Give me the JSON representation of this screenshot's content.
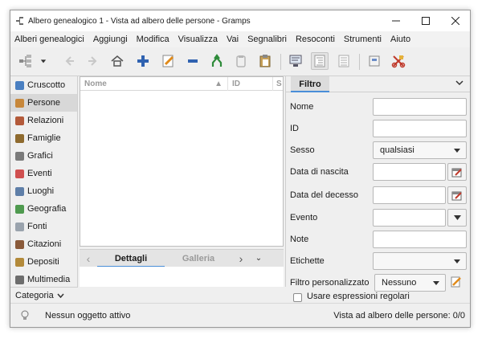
{
  "window": {
    "title": "Albero genealogico 1 - Vista ad albero delle persone - Gramps"
  },
  "menubar": [
    "Alberi genealogici",
    "Aggiungi",
    "Modifica",
    "Visualizza",
    "Vai",
    "Segnalibri",
    "Resoconti",
    "Strumenti",
    "Aiuto"
  ],
  "toolbar": {
    "icons": [
      "family-trees-icon",
      "dropdown-arrow-icon",
      "back-icon",
      "forward-icon",
      "home-icon",
      "add-icon",
      "edit-icon",
      "remove-icon",
      "merge-icon",
      "clipboard-icon",
      "paste-icon",
      "config-view-icon",
      "tree-view-icon",
      "flat-view-icon",
      "report-icon",
      "tools-icon"
    ]
  },
  "sidebar": {
    "items": [
      {
        "label": "Cruscotto",
        "icon": "dashboard-icon",
        "color": "#4a7fc1"
      },
      {
        "label": "Persone",
        "icon": "people-icon",
        "color": "#c7873a"
      },
      {
        "label": "Relazioni",
        "icon": "relationships-icon",
        "color": "#b35a3a"
      },
      {
        "label": "Famiglie",
        "icon": "families-icon",
        "color": "#8e6a2e"
      },
      {
        "label": "Grafici",
        "icon": "charts-icon",
        "color": "#7a7a7a"
      },
      {
        "label": "Eventi",
        "icon": "events-icon",
        "color": "#d05050"
      },
      {
        "label": "Luoghi",
        "icon": "places-icon",
        "color": "#5f7fa8"
      },
      {
        "label": "Geografia",
        "icon": "geography-icon",
        "color": "#4f9a4f"
      },
      {
        "label": "Fonti",
        "icon": "sources-icon",
        "color": "#9aa3ad"
      },
      {
        "label": "Citazioni",
        "icon": "citations-icon",
        "color": "#8a5a3a"
      },
      {
        "label": "Depositi",
        "icon": "repositories-icon",
        "color": "#b38a3a"
      },
      {
        "label": "Multimedia",
        "icon": "media-icon",
        "color": "#6d6d6d"
      }
    ],
    "active_index": 1,
    "category_label": "Categoria"
  },
  "list": {
    "columns": [
      "Nome",
      "ID",
      "S"
    ]
  },
  "bottombar": {
    "tabs": [
      "Dettagli",
      "Galleria"
    ],
    "active": "Dettagli"
  },
  "filter": {
    "tab_label": "Filtro",
    "fields": [
      {
        "label": "Nome",
        "type": "text",
        "value": ""
      },
      {
        "label": "ID",
        "type": "text",
        "value": ""
      },
      {
        "label": "Sesso",
        "type": "combo",
        "value": "qualsiasi"
      },
      {
        "label": "Data di nascita",
        "type": "date",
        "value": ""
      },
      {
        "label": "Data del decesso",
        "type": "date",
        "value": ""
      },
      {
        "label": "Evento",
        "type": "combo-entry",
        "value": ""
      },
      {
        "label": "Note",
        "type": "text",
        "value": ""
      },
      {
        "label": "Etichette",
        "type": "combo",
        "value": ""
      },
      {
        "label": "Filtro personalizzato",
        "type": "combo-edit",
        "value": "Nessuno"
      }
    ],
    "regex_label": "Usare espressioni regolari"
  },
  "status": {
    "left": "Nessun oggetto attivo",
    "right": "Vista ad albero delle persone: 0/0"
  }
}
